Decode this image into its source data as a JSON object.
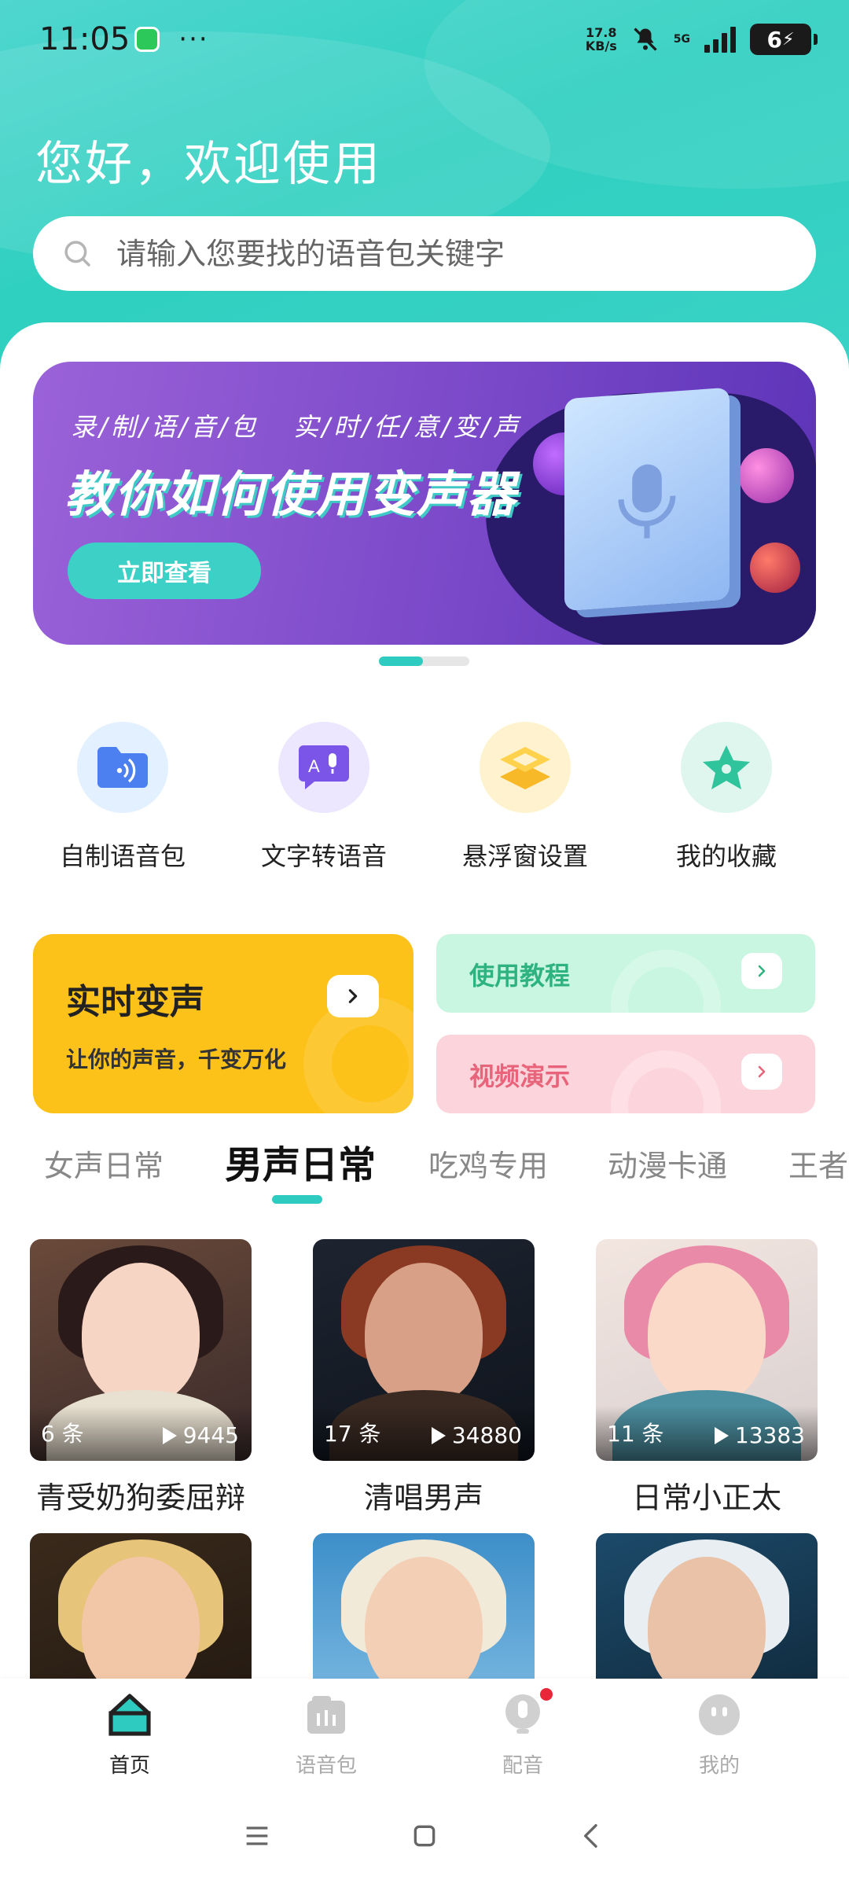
{
  "status_bar": {
    "time": "11:05",
    "dots": "···",
    "net_speed_value": "17.8",
    "net_speed_unit": "KB/s",
    "network": "5G",
    "battery": "6"
  },
  "header": {
    "greeting": "您好，欢迎使用",
    "search_placeholder": "请输入您要找的语音包关键字"
  },
  "banner": {
    "subtitle": "录/制/语/音/包 实/时/任/意/变/声",
    "title": "教你如何使用变声器",
    "button": "立即查看"
  },
  "quick_actions": [
    {
      "label": "自制语音包",
      "icon": "folder-audio-icon",
      "bg": "#e3f0ff",
      "color": "#4c7ff0"
    },
    {
      "label": "文字转语音",
      "icon": "text-to-speech-icon",
      "bg": "#ede6ff",
      "color": "#7b55e8"
    },
    {
      "label": "悬浮窗设置",
      "icon": "layers-icon",
      "bg": "#fff3cf",
      "color": "#f7b928"
    },
    {
      "label": "我的收藏",
      "icon": "star-icon",
      "bg": "#dff6ee",
      "color": "#2fc49c"
    }
  ],
  "features": {
    "realtime": {
      "title": "实时变声",
      "desc": "让你的声音，千变万化"
    },
    "tutorial": {
      "title": "使用教程"
    },
    "demo": {
      "title": "视频演示"
    }
  },
  "tabs": [
    "女声日常",
    "男声日常",
    "吃鸡专用",
    "动漫卡通",
    "王者"
  ],
  "active_tab": "男声日常",
  "packs": [
    {
      "count": "6 条",
      "plays": "9445",
      "name": "青受奶狗委屈辩"
    },
    {
      "count": "17 条",
      "plays": "34880",
      "name": "清唱男声"
    },
    {
      "count": "11 条",
      "plays": "13383",
      "name": "日常小正太"
    },
    {
      "count": "",
      "plays": "",
      "name": ""
    },
    {
      "count": "",
      "plays": "",
      "name": ""
    },
    {
      "count": "",
      "plays": "",
      "name": ""
    }
  ],
  "bottom_nav": [
    {
      "label": "首页",
      "icon": "home-icon",
      "active": true
    },
    {
      "label": "语音包",
      "icon": "voice-pack-icon",
      "active": false
    },
    {
      "label": "配音",
      "icon": "microphone-icon",
      "active": false
    },
    {
      "label": "我的",
      "icon": "profile-icon",
      "active": false
    }
  ],
  "colors": {
    "accent": "#2ecbc1",
    "banner": "#7a49c9",
    "realtime_card": "#fcc21a",
    "tutorial_card": "#c8f6e1",
    "demo_card": "#fcd4dc"
  }
}
